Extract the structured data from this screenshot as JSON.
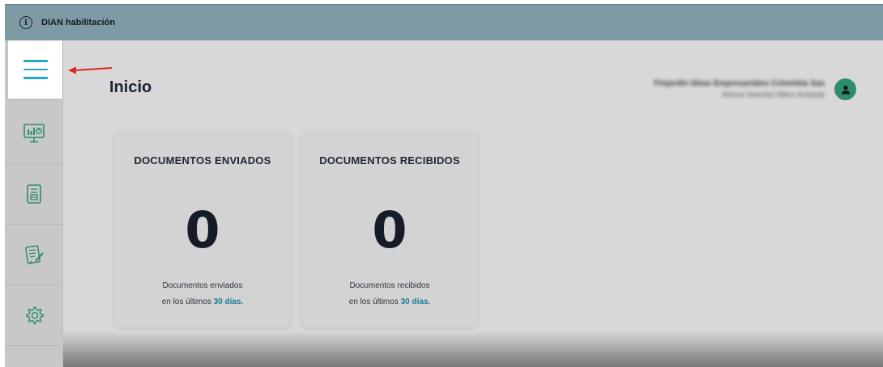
{
  "topbar": {
    "title": "DIAN habilitación",
    "info_icon": "info-icon"
  },
  "sidebar": {
    "menu_icon": "hamburger-menu-icon",
    "items": [
      {
        "icon": "dashboard-monitor-icon"
      },
      {
        "icon": "documents-icon"
      },
      {
        "icon": "report-edit-icon"
      },
      {
        "icon": "gear-icon"
      }
    ]
  },
  "page": {
    "title": "Inicio"
  },
  "user": {
    "name": "Finjardín Ideas Empresariales Colombia Sas",
    "role": "Alonso Sanchez Milico Andrade"
  },
  "cards": [
    {
      "title": "DOCUMENTOS ENVIADOS",
      "value": "0",
      "caption_line1": "Documentos enviados",
      "caption_prefix": "en los últimos",
      "caption_accent": "30 días",
      "caption_suffix": "."
    },
    {
      "title": "DOCUMENTOS RECIBIDOS",
      "value": "0",
      "caption_line1": "Documentos recibidos",
      "caption_prefix": "en los últimos",
      "caption_accent": "30 días",
      "caption_suffix": "."
    }
  ],
  "colors": {
    "accent": "#2aa6c4",
    "topbar": "#7e9aa4",
    "avatar": "#2f8d6b",
    "arrow": "#e0261c"
  }
}
